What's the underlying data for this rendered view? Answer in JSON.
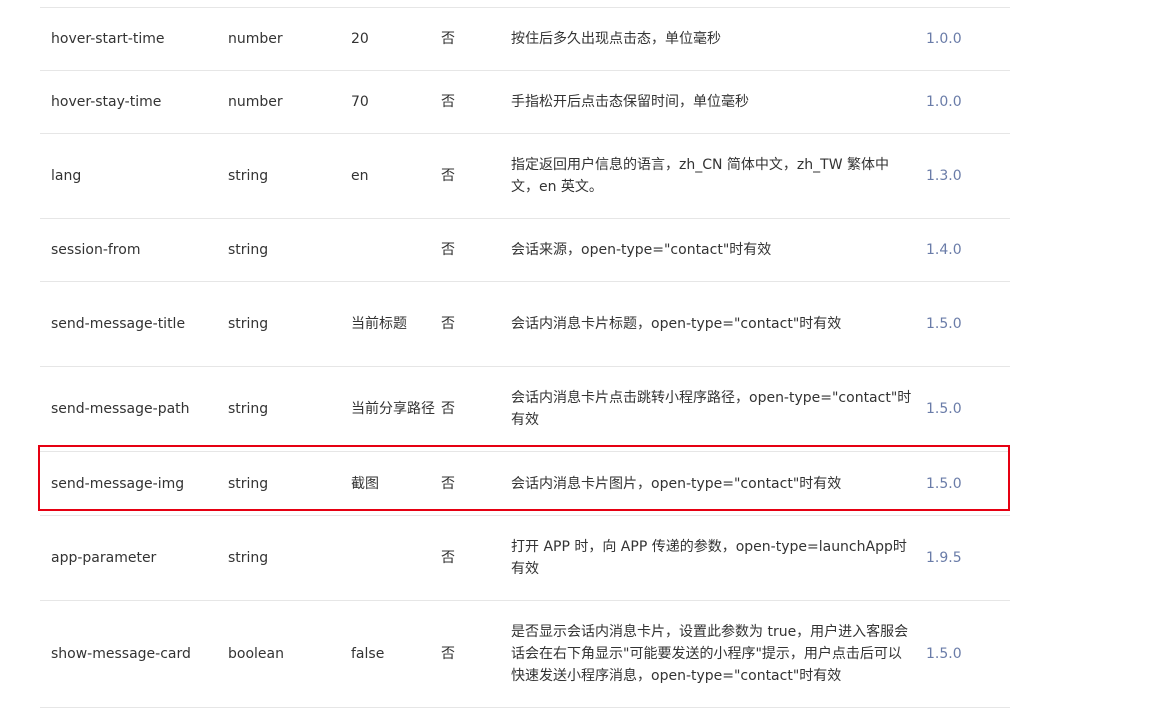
{
  "table": {
    "rows": [
      {
        "name": "hover-start-time",
        "type": "number",
        "default": "20",
        "required": "否",
        "desc": "按住后多久出现点击态，单位毫秒",
        "version": "1.0.0"
      },
      {
        "name": "hover-stay-time",
        "type": "number",
        "default": "70",
        "required": "否",
        "desc": "手指松开后点击态保留时间，单位毫秒",
        "version": "1.0.0"
      },
      {
        "name": "lang",
        "type": "string",
        "default": "en",
        "required": "否",
        "desc": "指定返回用户信息的语言，zh_CN 简体中文，zh_TW 繁体中文，en 英文。",
        "version": "1.3.0"
      },
      {
        "name": "session-from",
        "type": "string",
        "default": "",
        "required": "否",
        "desc": "会话来源，open-type=\"contact\"时有效",
        "version": "1.4.0"
      },
      {
        "name": "send-message-title",
        "type": "string",
        "default": "当前标题",
        "required": "否",
        "desc": "会话内消息卡片标题，open-type=\"contact\"时有效",
        "version": "1.5.0"
      },
      {
        "name": "send-message-path",
        "type": "string",
        "default": "当前分享路径",
        "required": "否",
        "desc": "会话内消息卡片点击跳转小程序路径，open-type=\"contact\"时有效",
        "version": "1.5.0"
      },
      {
        "name": "send-message-img",
        "type": "string",
        "default": "截图",
        "required": "否",
        "desc": "会话内消息卡片图片，open-type=\"contact\"时有效",
        "version": "1.5.0"
      },
      {
        "name": "app-parameter",
        "type": "string",
        "default": "",
        "required": "否",
        "desc": "打开 APP 时，向 APP 传递的参数，open-type=launchApp时有效",
        "version": "1.9.5"
      },
      {
        "name": "show-message-card",
        "type": "boolean",
        "default": "false",
        "required": "否",
        "desc": "是否显示会话内消息卡片，设置此参数为 true，用户进入客服会话会在右下角显示\"可能要发送的小程序\"提示，用户点击后可以快速发送小程序消息，open-type=\"contact\"时有效",
        "version": "1.5.0"
      }
    ]
  },
  "highlight_color": "#e60012"
}
